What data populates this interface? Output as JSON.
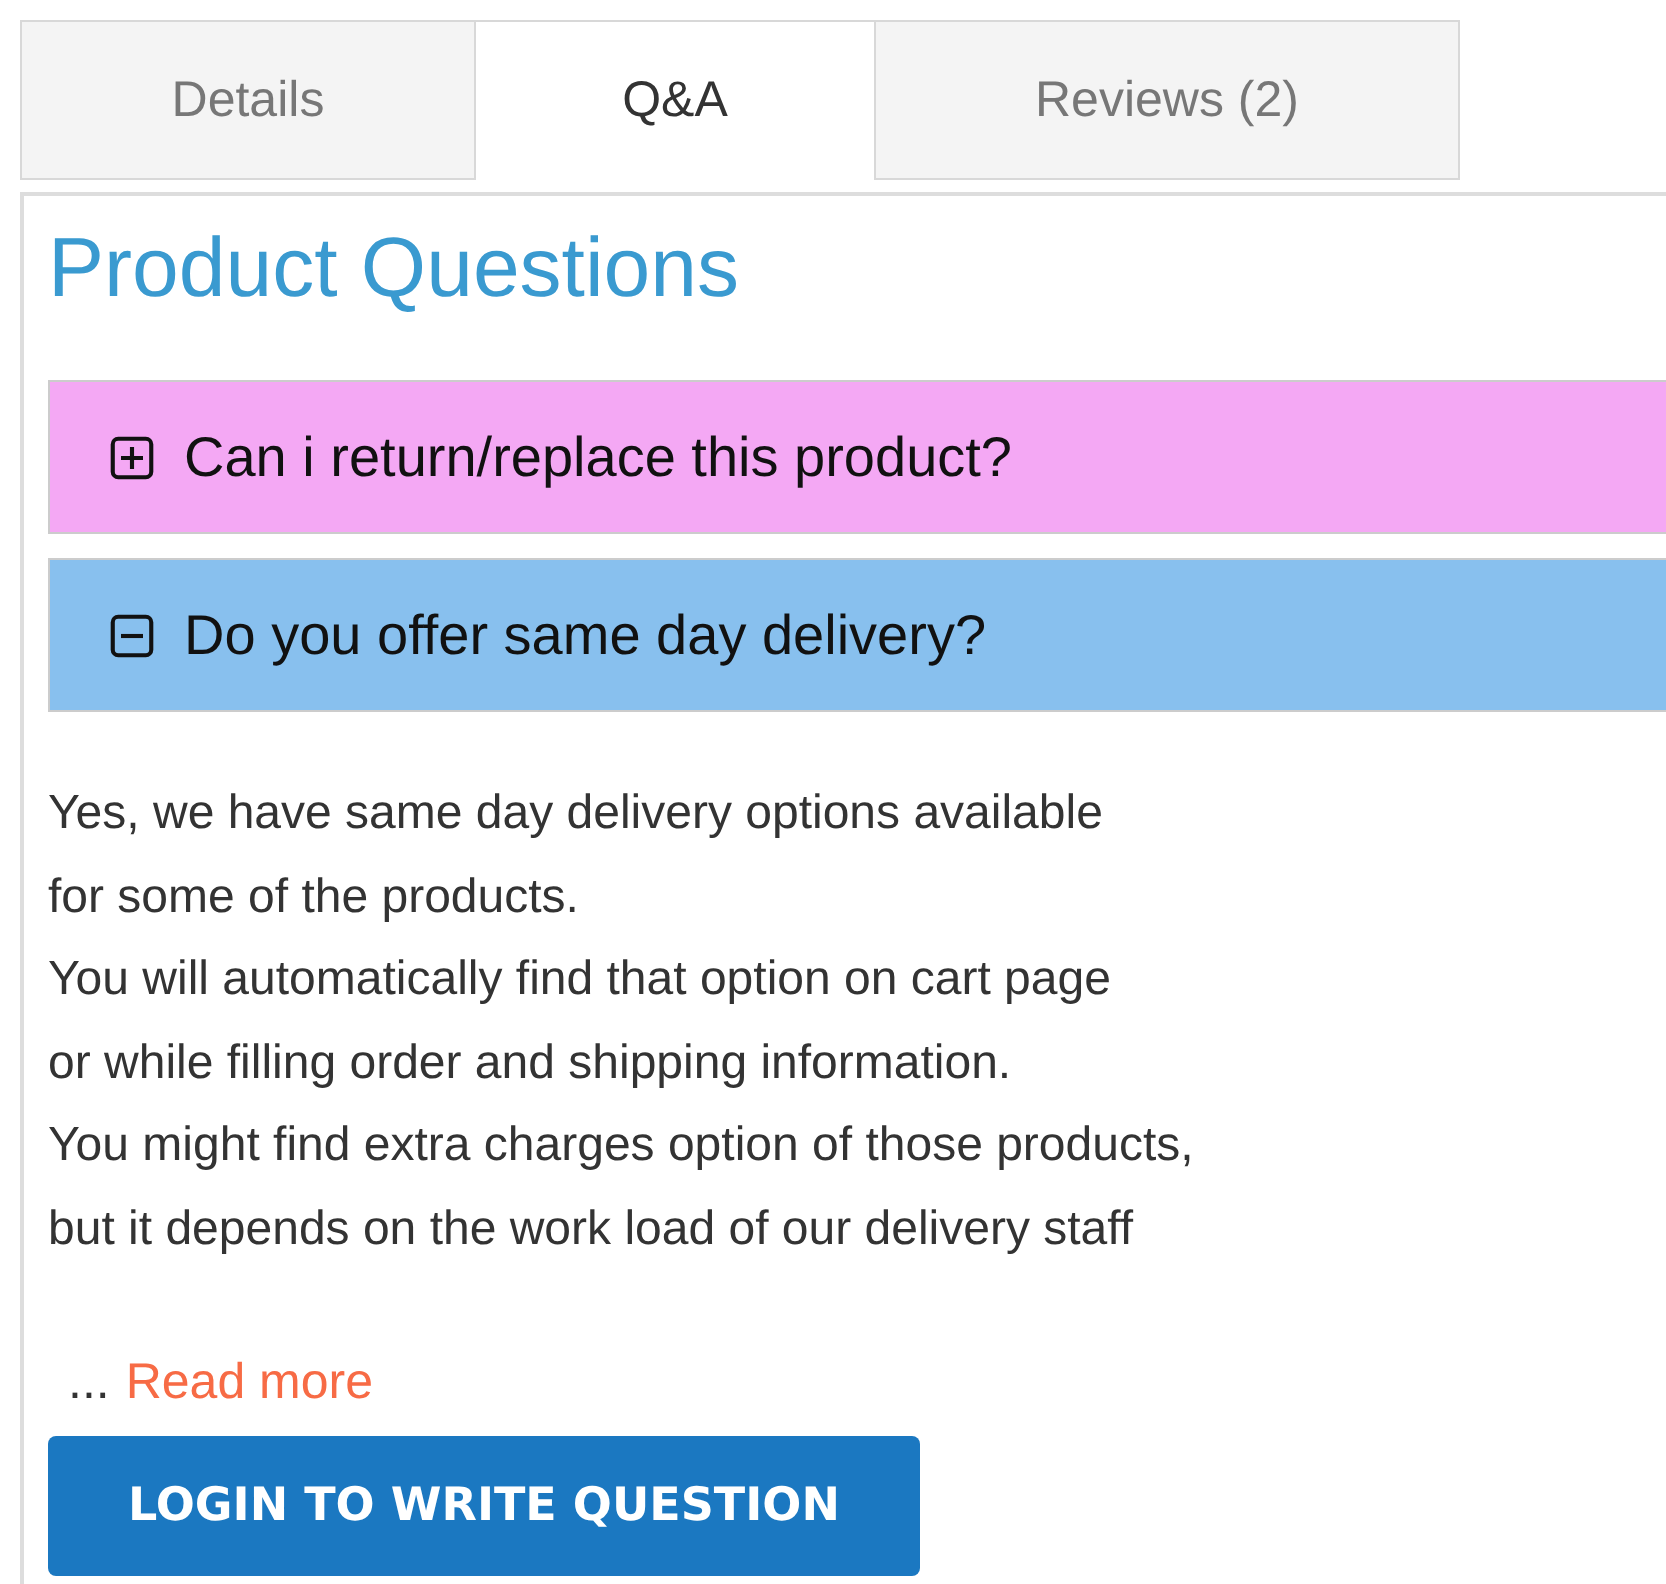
{
  "tabs": [
    {
      "label": "Details",
      "selected": false
    },
    {
      "label": "Q&A",
      "selected": true
    },
    {
      "label": "Reviews (2)",
      "selected": false
    }
  ],
  "title": "Product Questions",
  "questions": [
    {
      "question": "Can i return/replace this product?",
      "expanded": false,
      "color": "#f4a8f4"
    },
    {
      "question": "Do you offer same day delivery?",
      "expanded": true,
      "color": "#88c0ee",
      "answer": [
        "Yes, we have same day delivery options available",
        "for some of the products.",
        "You will automatically find that option on cart page",
        "or while filling order and shipping information.",
        "You might find extra charges option of those products,",
        " but it depends on the work load of our delivery staff"
      ],
      "ellipsis": "...",
      "read_more": "Read more"
    }
  ],
  "button": "LOGIN TO WRITE QUESTION"
}
